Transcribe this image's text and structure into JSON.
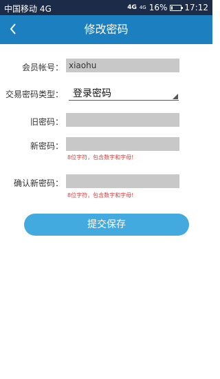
{
  "status_bar": {
    "carrier": "中国移动 4G",
    "net1": "4G",
    "net2": "4G",
    "battery": "16%",
    "battery_level": 0.16,
    "time": "17:12"
  },
  "header": {
    "title": "修改密码",
    "back_icon": "chevron-left-icon"
  },
  "form": {
    "account_label": "会员帐号：",
    "account_value": "xiaohu",
    "type_label": "交易密码类型：",
    "type_value": "登录密码",
    "old_label": "旧密码：",
    "old_value": "",
    "new_label": "新密码：",
    "new_value": "",
    "new_hint": "8位字符，包含数字和字母!",
    "confirm_label": "确认新密码：",
    "confirm_value": "",
    "confirm_hint": "8位字符，包含数字和字母!",
    "submit_label": "提交保存"
  },
  "colors": {
    "status_bg": "#1c2b48",
    "header_bg": "#1b7fc0",
    "button_bg": "#42aadf",
    "hint": "#e03a3a",
    "field_bg": "#c8c8c8"
  }
}
